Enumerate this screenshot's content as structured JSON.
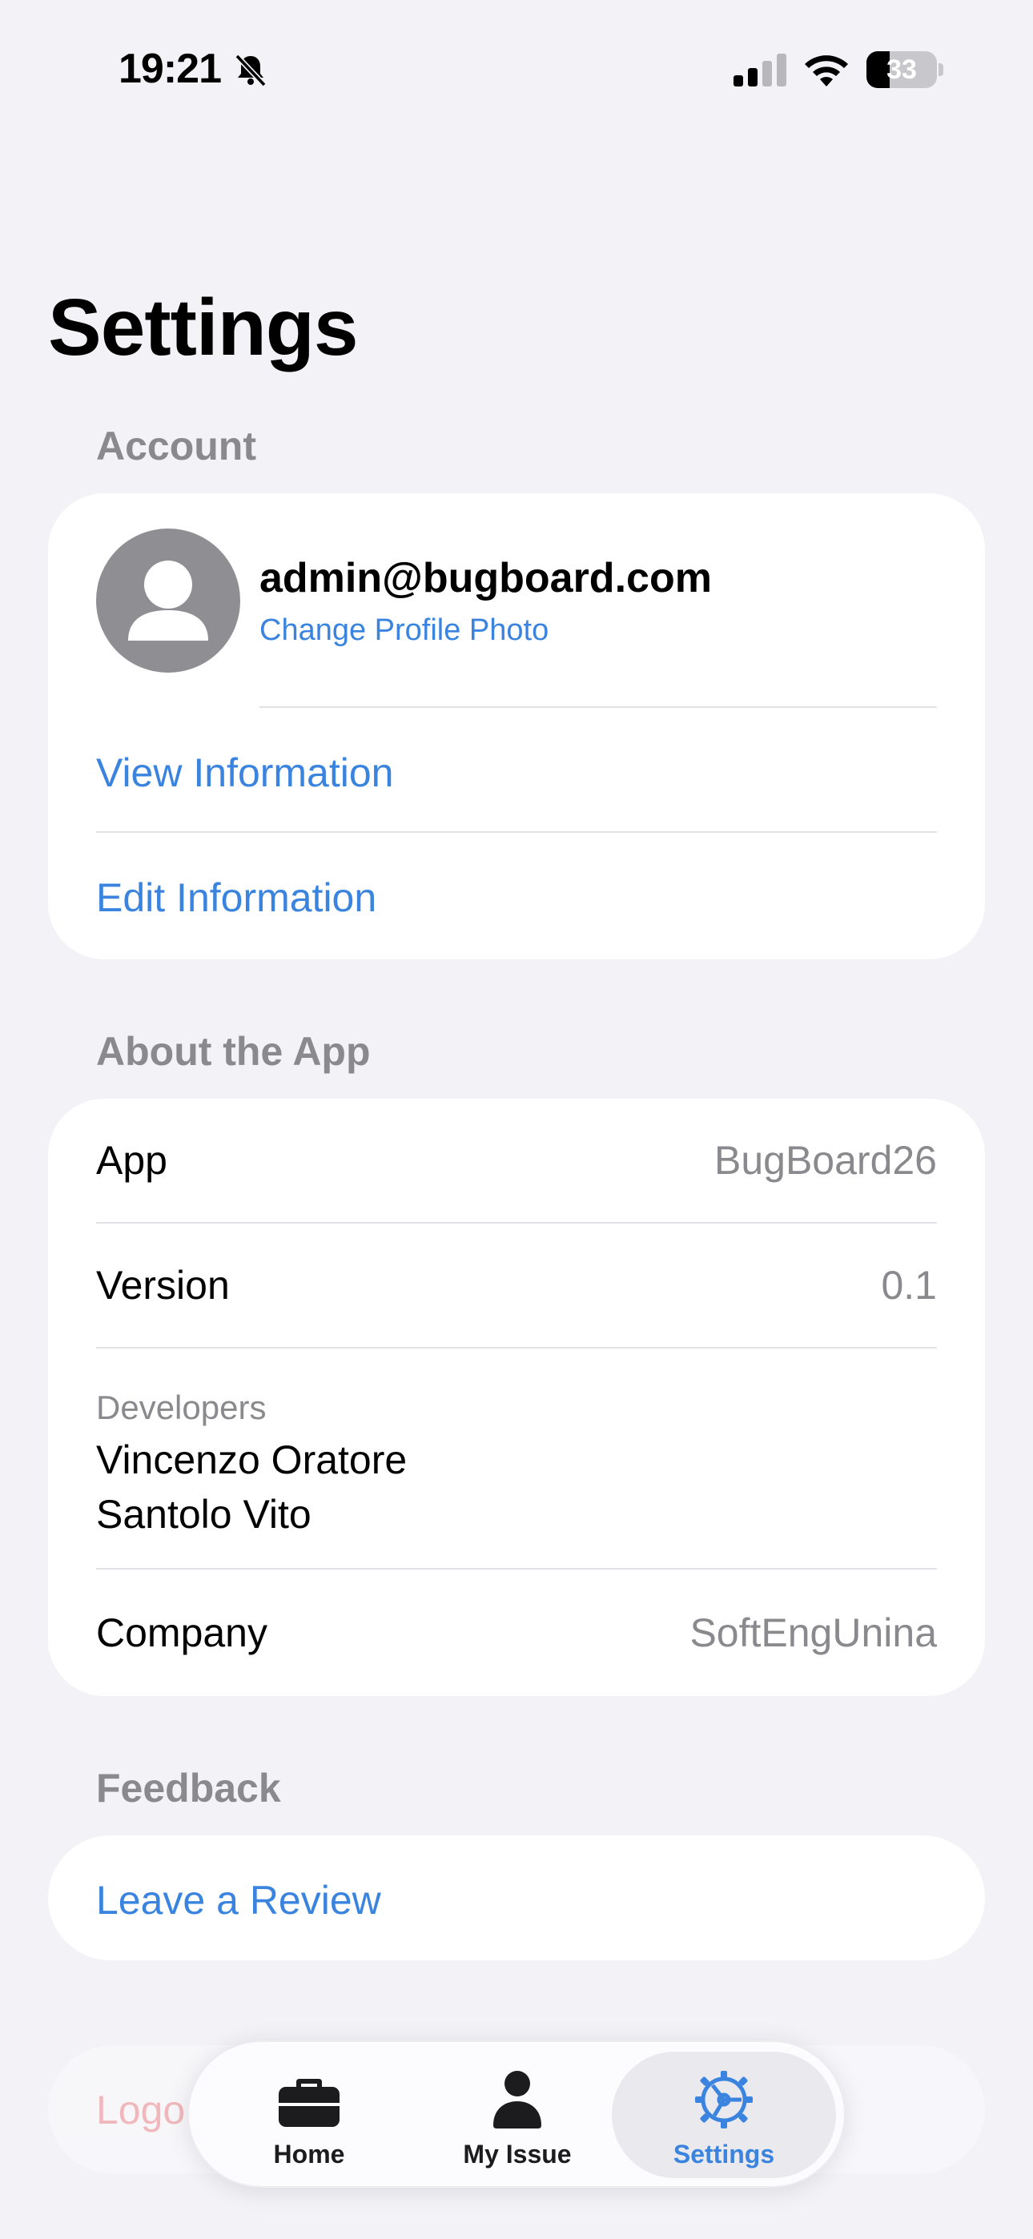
{
  "status_bar": {
    "time": "19:21",
    "battery": "33",
    "battery_level": 0.33,
    "icons": [
      "bell-slash-icon",
      "signal-icon",
      "wifi-icon",
      "battery-icon"
    ]
  },
  "page": {
    "title": "Settings"
  },
  "account": {
    "header": "Account",
    "email": "admin@bugboard.com",
    "change_photo": "Change Profile Photo",
    "view_info": "View Information",
    "edit_info": "Edit Information"
  },
  "about": {
    "header": "About the App",
    "app_label": "App",
    "app_value": "BugBoard26",
    "version_label": "Version",
    "version_value": "0.1",
    "developers_label": "Developers",
    "developers": [
      "Vincenzo Oratore",
      "Santolo Vito"
    ],
    "company_label": "Company",
    "company_value": "SoftEngUnina"
  },
  "feedback": {
    "header": "Feedback",
    "review": "Leave a Review"
  },
  "logout": {
    "label": "Logo"
  },
  "tab_bar": {
    "items": [
      {
        "label": "Home",
        "icon": "briefcase-icon",
        "active": false
      },
      {
        "label": "My Issue",
        "icon": "person-icon",
        "active": false
      },
      {
        "label": "Settings",
        "icon": "gear-icon",
        "active": true
      }
    ]
  },
  "colors": {
    "accent": "#3a84e0",
    "background": "#f2f2f7",
    "secondary_text": "#8a8a8e"
  }
}
